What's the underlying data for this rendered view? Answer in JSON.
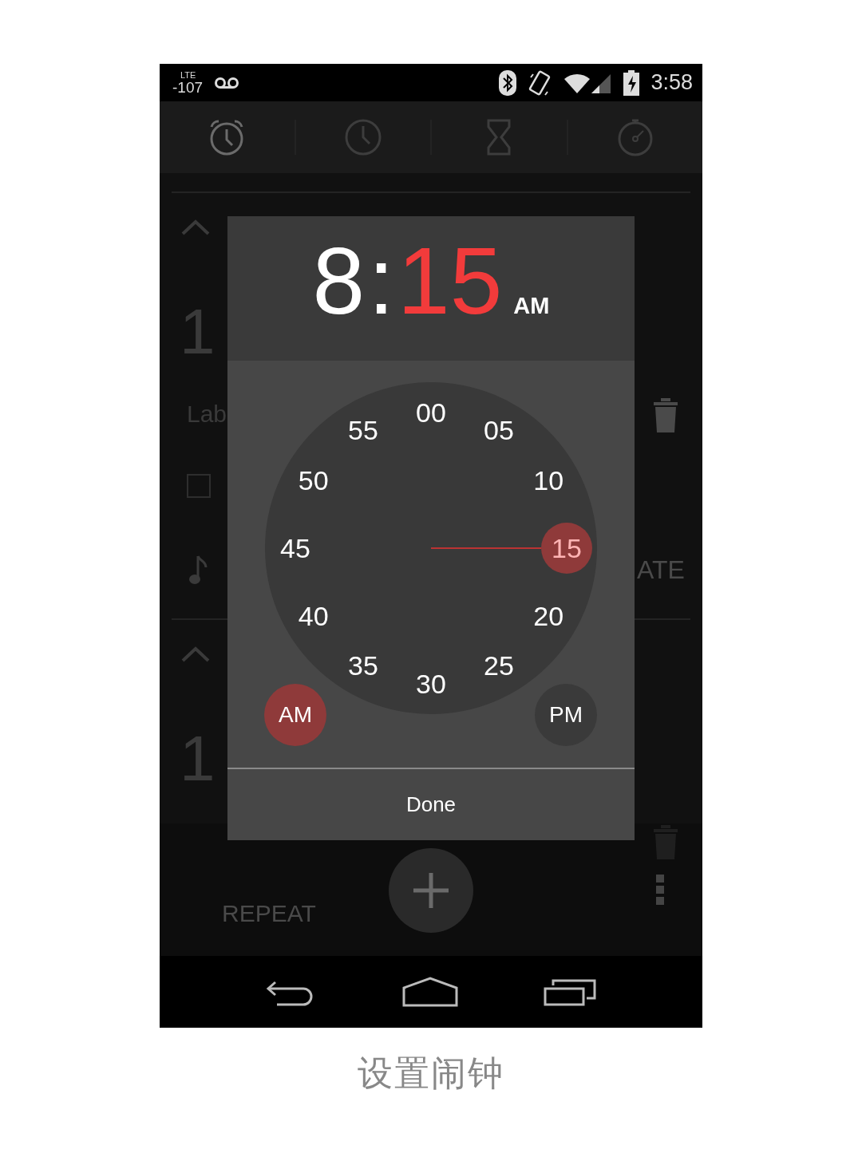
{
  "status_bar": {
    "network": "LTE",
    "signal_reading": "-107",
    "time": "3:58"
  },
  "tabs": [
    {
      "kind": "alarm",
      "selected": true
    },
    {
      "kind": "clock",
      "selected": false
    },
    {
      "kind": "timer",
      "selected": false
    },
    {
      "kind": "stopwatch",
      "selected": false
    }
  ],
  "alarm_list": {
    "alarm_1_time": "1",
    "alarm_1_label": "Lab",
    "alarm_1_checked": false,
    "alarm_1_vibrate": "ATE",
    "alarm_2_time": "1",
    "alarm_2_repeat": "REPEAT"
  },
  "time_picker": {
    "hour": "8",
    "separator": ":",
    "minute": "15",
    "meridiem": "AM",
    "minutes": [
      {
        "label": "00",
        "selected": false
      },
      {
        "label": "05",
        "selected": false
      },
      {
        "label": "10",
        "selected": false
      },
      {
        "label": "15",
        "selected": true
      },
      {
        "label": "20",
        "selected": false
      },
      {
        "label": "25",
        "selected": false
      },
      {
        "label": "30",
        "selected": false
      },
      {
        "label": "35",
        "selected": false
      },
      {
        "label": "40",
        "selected": false
      },
      {
        "label": "45",
        "selected": false
      },
      {
        "label": "50",
        "selected": false
      },
      {
        "label": "55",
        "selected": false
      }
    ],
    "am": {
      "label": "AM",
      "selected": true
    },
    "pm": {
      "label": "PM",
      "selected": false
    },
    "done": "Done"
  },
  "caption": "设置闹钟"
}
